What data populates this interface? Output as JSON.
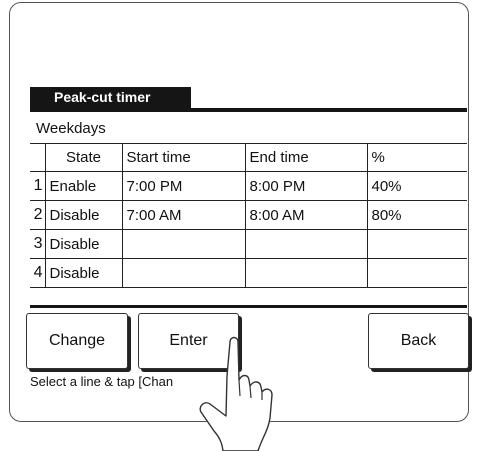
{
  "screen": {
    "title": "Peak-cut timer",
    "day_label": "Weekdays"
  },
  "table": {
    "headers": [
      "State",
      "Start time",
      "End time",
      "%"
    ],
    "rows": [
      {
        "num": "1",
        "state": "Enable",
        "start": "7:00  PM",
        "end": "8:00  PM",
        "pct": "40%"
      },
      {
        "num": "2",
        "state": "Disable",
        "start": "7:00  AM",
        "end": "8:00  AM",
        "pct": "80%"
      },
      {
        "num": "3",
        "state": "Disable",
        "start": "",
        "end": "",
        "pct": ""
      },
      {
        "num": "4",
        "state": "Disable",
        "start": "",
        "end": "",
        "pct": ""
      }
    ]
  },
  "buttons": {
    "change": "Change",
    "enter": "Enter",
    "back": "Back"
  },
  "hint": "Select a line & tap [Chan",
  "icons": {
    "hand": "pointing-hand-icon"
  }
}
